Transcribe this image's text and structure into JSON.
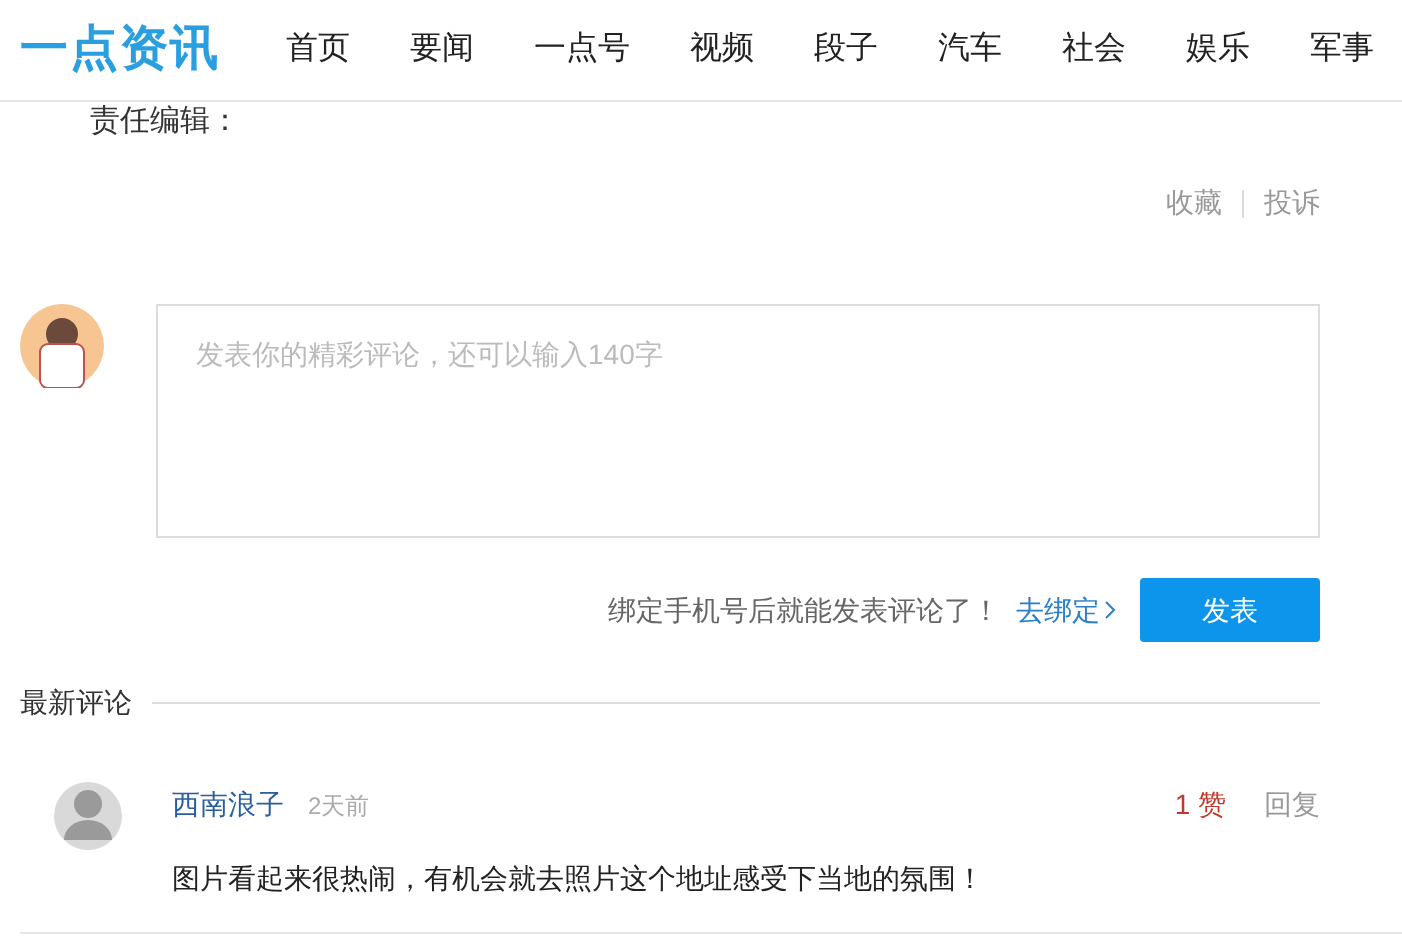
{
  "header": {
    "logo": "一点资讯",
    "nav": [
      "首页",
      "要闻",
      "一点号",
      "视频",
      "段子",
      "汽车",
      "社会",
      "娱乐",
      "军事"
    ]
  },
  "article": {
    "editor_label": "责任编辑：",
    "actions": [
      "收藏",
      "投诉"
    ]
  },
  "composer": {
    "placeholder": "发表你的精彩评论，还可以输入140字",
    "bind_notice": "绑定手机号后就能发表评论了！",
    "bind_link": "去绑定",
    "submit": "发表"
  },
  "comments_heading": "最新评论",
  "comments": [
    {
      "user": "西南浪子",
      "time": "2天前",
      "likes": "1 赞",
      "reply": "回复",
      "text": "图片看起来很热闹，有机会就去照片这个地址感受下当地的氛围！"
    }
  ]
}
